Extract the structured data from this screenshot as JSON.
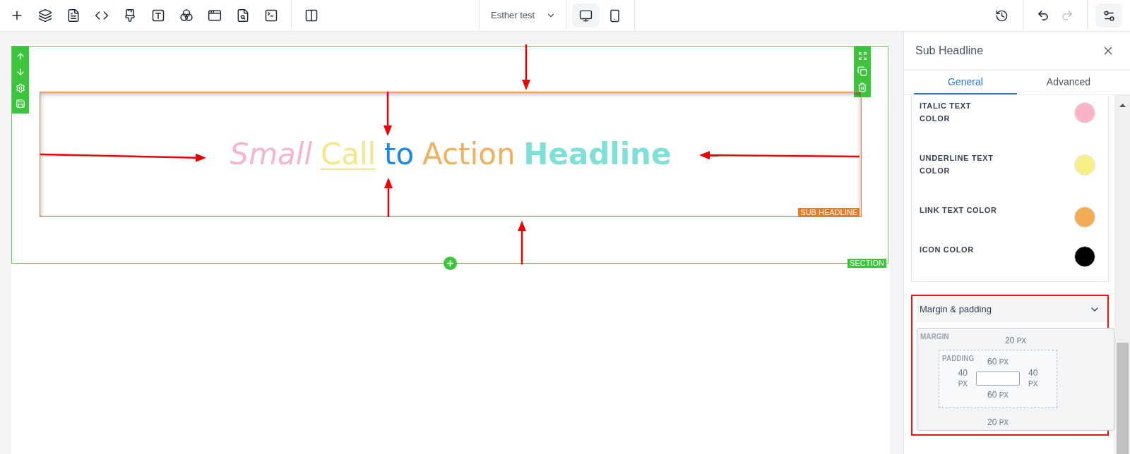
{
  "topbar": {
    "project_selector": {
      "value": "Esther test"
    },
    "devices": [
      {
        "kind": "desktop",
        "selected": true
      },
      {
        "kind": "mobile",
        "selected": false
      }
    ],
    "history_actions": [
      {
        "kind": "undo",
        "disabled": false
      },
      {
        "kind": "redo",
        "disabled": true
      }
    ]
  },
  "canvas": {
    "section": {
      "badge": "SECTION"
    },
    "element": {
      "badge": "SUB HEADLINE",
      "segments": [
        {
          "kind": "italic",
          "text": "Small"
        },
        {
          "kind": "underline",
          "text": "Call"
        },
        {
          "kind": "plain",
          "text": "to"
        },
        {
          "kind": "link",
          "text": "Action"
        },
        {
          "kind": "bold",
          "text": "Headline"
        }
      ]
    }
  },
  "panel": {
    "title": "Sub Headline",
    "tabs": [
      {
        "label": "General",
        "selected": true
      },
      {
        "label": "Advanced",
        "selected": false
      }
    ],
    "color_settings": [
      {
        "label": "ITALIC TEXT\nCOLOR",
        "color": "#f9b4c8"
      },
      {
        "label": "UNDERLINE TEXT\nCOLOR",
        "color": "#f8ee8a"
      },
      {
        "label": "LINK TEXT COLOR",
        "color": "#f4ac55"
      },
      {
        "label": "ICON COLOR",
        "color": "#000000"
      }
    ],
    "spacing": {
      "title": "Margin & padding",
      "expanded": true,
      "margin": {
        "label": "MARGIN",
        "top": {
          "value": "20",
          "unit": "PX"
        },
        "bottom": {
          "value": "20",
          "unit": "PX"
        }
      },
      "padding": {
        "label": "PADDING",
        "top": {
          "value": "60",
          "unit": "PX"
        },
        "bottom": {
          "value": "60",
          "unit": "PX"
        },
        "left": {
          "value": "40",
          "unit": "PX"
        },
        "right": {
          "value": "40",
          "unit": "PX"
        }
      }
    }
  }
}
